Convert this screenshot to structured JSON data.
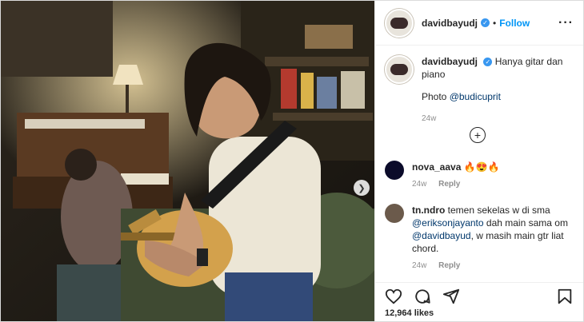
{
  "post": {
    "username": "davidbayudj",
    "follow_label": "Follow",
    "caption": "Hanya gitar dan piano",
    "photo_prefix": "Photo",
    "photo_credit": "@budicuprit",
    "time": "24w",
    "likes": "12,964 likes"
  },
  "comments": [
    {
      "username": "nova_aava",
      "text": "🔥😍🔥",
      "time": "24w",
      "reply": "Reply"
    },
    {
      "username": "tn.ndro",
      "text_a": "temen sekelas w di sma",
      "mention1": "@erikson​jayanto",
      "text_b": "dah main sama om",
      "mention2": "@davidbayud",
      "text_c": ", w masih main gtr liat chord.",
      "time": "24w",
      "reply": "Reply"
    }
  ],
  "icons": {
    "verified": "verified-badge-icon",
    "more": "more-options-icon",
    "add": "add-comment-icon",
    "like": "heart-icon",
    "comment": "comment-icon",
    "share": "share-icon",
    "save": "bookmark-icon",
    "next": "chevron-right-icon"
  }
}
